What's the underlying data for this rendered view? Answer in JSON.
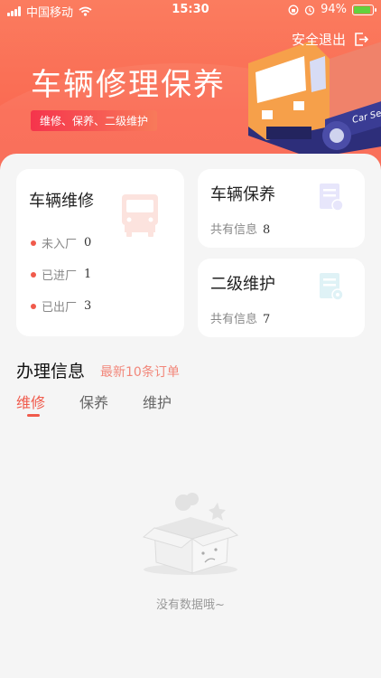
{
  "status_bar": {
    "carrier": "中国移动",
    "time": "15:30",
    "battery": "94%",
    "battery_level": 0.94
  },
  "header": {
    "logout_label": "安全退出",
    "title": "车辆修理保养",
    "subtitle": "维修、保养、二级维护",
    "truck_text": "Car Ser",
    "accent": "#fa6a52"
  },
  "cards": {
    "repair": {
      "title": "车辆维修",
      "stats": [
        {
          "label": "未入厂",
          "value": "0"
        },
        {
          "label": "已进厂",
          "value": "1"
        },
        {
          "label": "已出厂",
          "value": "3"
        }
      ]
    },
    "maintenance": {
      "title": "车辆保养",
      "info_label": "共有信息",
      "count": "8"
    },
    "second_level": {
      "title": "二级维护",
      "info_label": "共有信息",
      "count": "7"
    }
  },
  "section": {
    "title": "办理信息",
    "subtitle": "最新10条订单",
    "tabs": [
      "维修",
      "保养",
      "维护"
    ],
    "active_tab": 0
  },
  "empty_state": {
    "text": "没有数据哦~"
  }
}
